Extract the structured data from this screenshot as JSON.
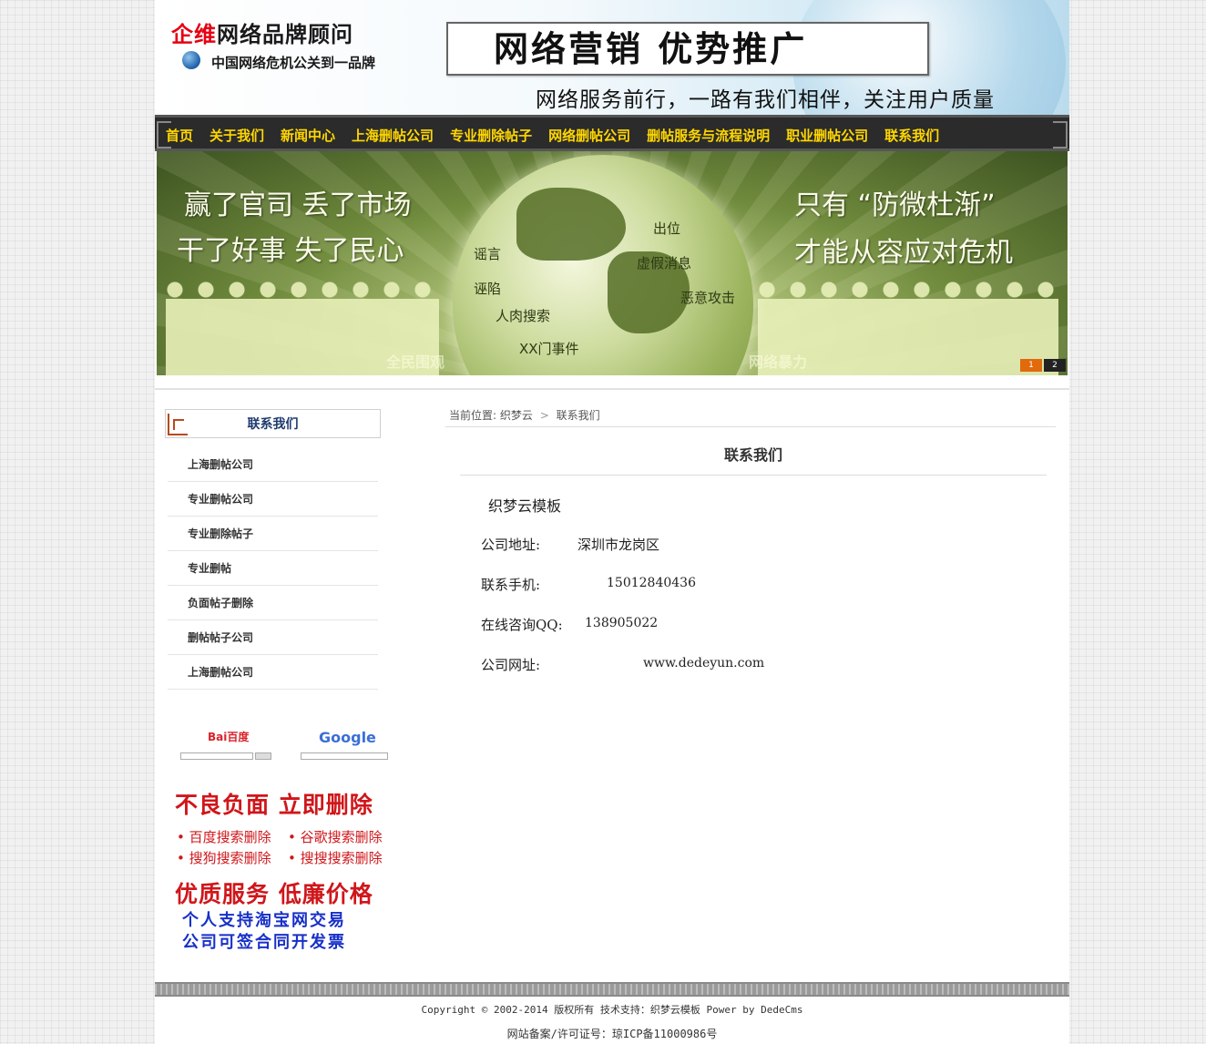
{
  "header": {
    "brand_red": "企维",
    "brand_rest": "网络品牌顾问",
    "subtitle": "中国网络危机公关到一品牌",
    "slogan": "网络营销 优势推广",
    "tagline": "网络服务前行，一路有我们相伴，关注用户质量"
  },
  "nav": {
    "items": [
      "首页",
      "关于我们",
      "新闻中心",
      "上海删帖公司",
      "专业删除帖子",
      "网络删帖公司",
      "删帖服务与流程说明",
      "职业删帖公司",
      "联系我们"
    ]
  },
  "banner": {
    "left_line1": "赢了官司  丢了市场",
    "left_line2": "干了好事  失了民心",
    "right_line1": "只有  “防微杜渐”",
    "right_line2": "才能从容应对危机",
    "globe_words": [
      "谣言",
      "出位",
      "虚假消息",
      "诬陷",
      "恶意攻击",
      "人肉搜索",
      "XX门事件"
    ],
    "faint_left": "全民围观",
    "faint_right": "网络暴力",
    "pager": [
      "1",
      "2"
    ],
    "active_page": "1"
  },
  "sidebar": {
    "title": "联系我们",
    "items": [
      "上海删帖公司",
      "专业删帖公司",
      "专业删除帖子",
      "专业删帖",
      "负面帖子删除",
      "删帖帖子公司",
      "上海删帖公司"
    ]
  },
  "ad": {
    "baidu": "Bai百度",
    "google": "Google",
    "line1": "不良负面  立即删除",
    "bullet1": "• 百度搜索删除",
    "bullet2": "• 谷歌搜索删除",
    "bullet3": "• 搜狗搜索删除",
    "bullet4": "• 搜搜搜索删除",
    "line2": "优质服务  低廉价格",
    "line3": "个人支持淘宝网交易",
    "line4": "公司可签合同开发票"
  },
  "breadcrumb": {
    "prefix": "当前位置:",
    "home": "织梦云",
    "sep": ">",
    "current": "联系我们"
  },
  "main": {
    "title": "联系我们",
    "company": "织梦云模板",
    "address_label": "公司地址:",
    "address_value": "深圳市龙岗区",
    "phone_label": "联系手机:",
    "phone_value": "15012840436",
    "qq_label": "在线咨询QQ:",
    "qq_value": "138905022",
    "site_label": "公司网址:",
    "site_value": "www.dedeyun.com"
  },
  "footer": {
    "copyright": "Copyright © 2002-2014 版权所有 技术支持：织梦云模板 Power by DedeCms",
    "icp": "网站备案/许可证号：琼ICP备11000986号"
  },
  "colors": {
    "nav_bg": "#2b2b2b",
    "nav_text": "#ffd700",
    "brand_red": "#e60012",
    "side_title": "#1e3a6e",
    "ad_red": "#d0161a",
    "ad_blue": "#1830c8"
  }
}
